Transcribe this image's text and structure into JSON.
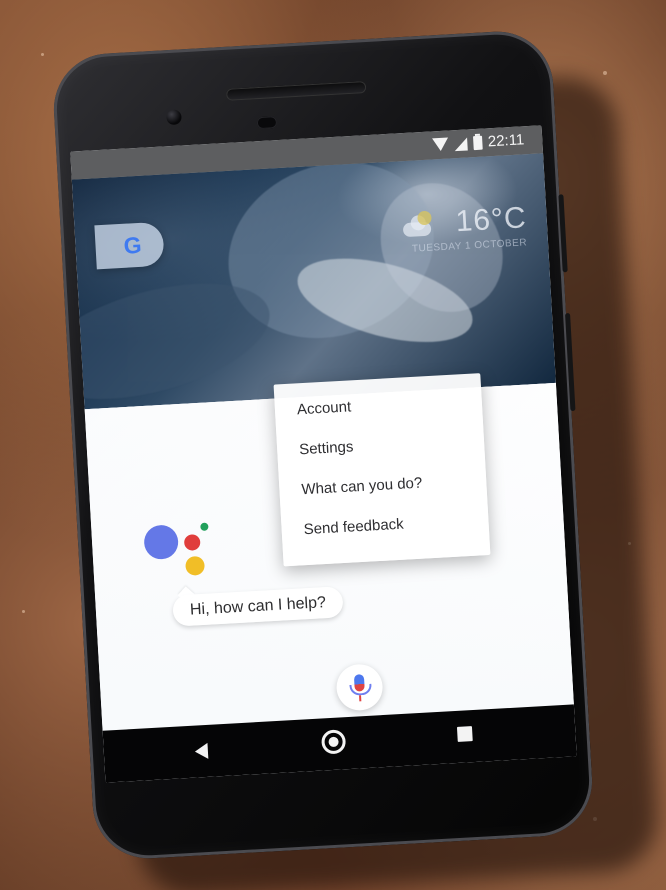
{
  "status_bar": {
    "time": "22:11"
  },
  "home_screen": {
    "google_button_icon": "G",
    "weather": {
      "temperature": "16°C",
      "date": "TUESDAY 1 OCTOBER"
    }
  },
  "assistant": {
    "greeting": "Hi, how can I help?",
    "colors": {
      "blue": "#6478e7",
      "red": "#e03d3c",
      "yellow": "#f1be27",
      "green": "#21a05b"
    },
    "mic_icon": "microphone-icon",
    "menu": {
      "items": [
        {
          "label": "Account"
        },
        {
          "label": "Settings"
        },
        {
          "label": "What can you do?"
        },
        {
          "label": "Send feedback"
        }
      ]
    }
  },
  "navigation": {
    "icons": [
      "back-icon",
      "home-icon",
      "recents-icon"
    ]
  }
}
